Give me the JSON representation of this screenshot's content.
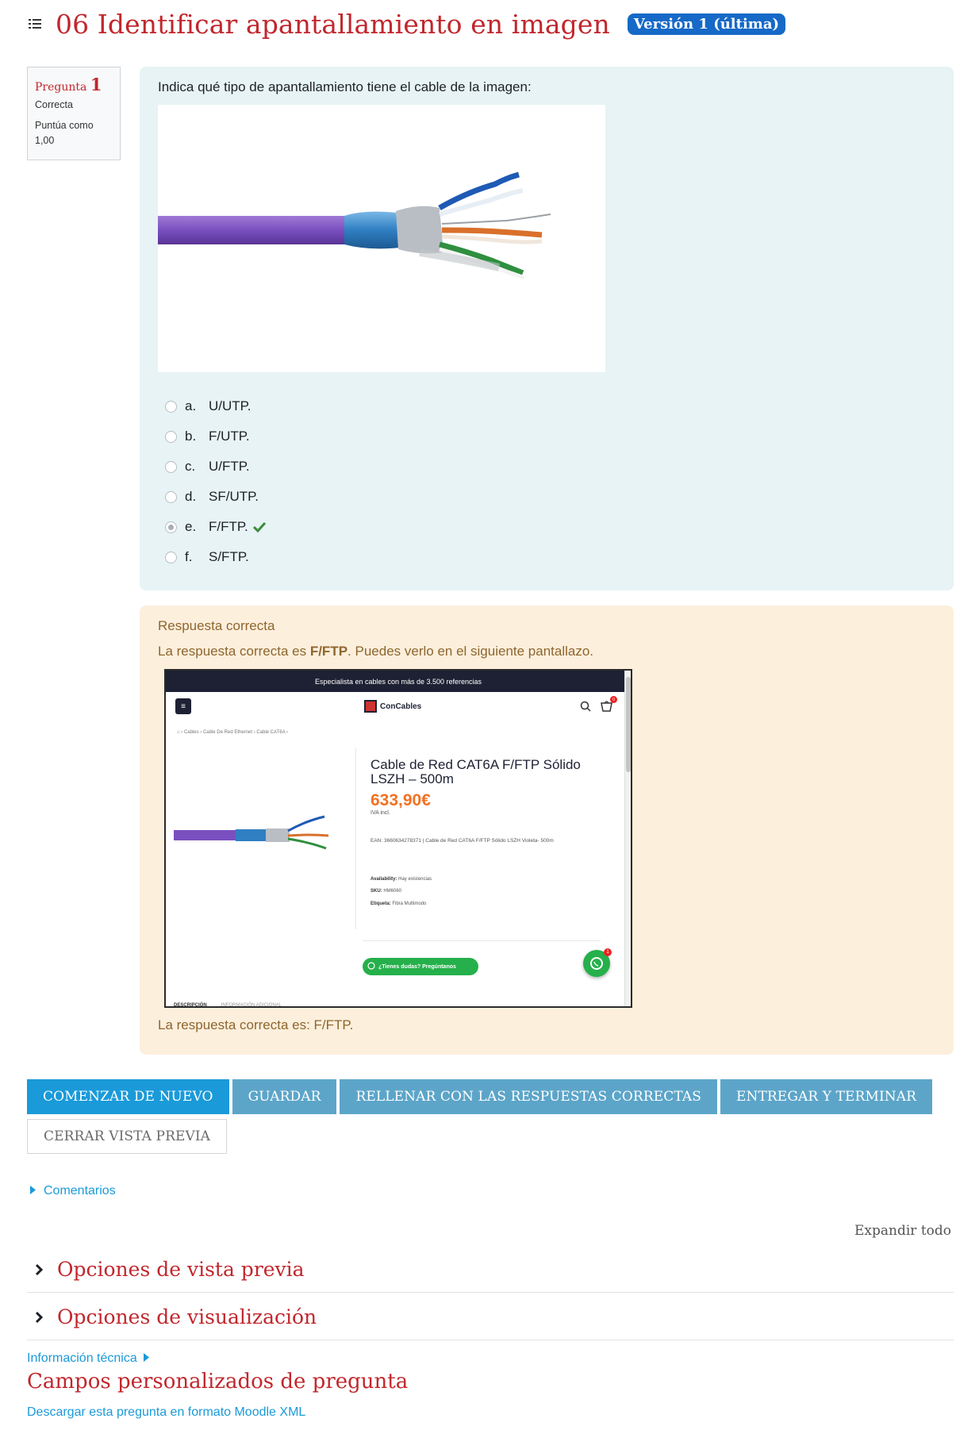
{
  "header": {
    "title": "06 Identificar apantallamiento en imagen",
    "version_badge": "Versión 1 (última)"
  },
  "question_info": {
    "label": "Pregunta",
    "number": "1",
    "state": "Correcta",
    "grade": "Puntúa como 1,00"
  },
  "question": {
    "prompt": "Indica qué tipo de apantallamiento tiene el cable de la imagen:",
    "answers": [
      {
        "letter": "a.",
        "text": "U/UTP.",
        "selected": false
      },
      {
        "letter": "b.",
        "text": "F/UTP.",
        "selected": false
      },
      {
        "letter": "c.",
        "text": "U/FTP.",
        "selected": false
      },
      {
        "letter": "d.",
        "text": "SF/UTP.",
        "selected": false
      },
      {
        "letter": "e.",
        "text": "F/FTP.",
        "selected": true
      },
      {
        "letter": "f.",
        "text": "S/FTP.",
        "selected": false
      }
    ]
  },
  "feedback": {
    "heading": "Respuesta correcta",
    "line_prefix": "La respuesta correcta es ",
    "line_bold": "F/FTP",
    "line_suffix": ". Puedes verlo en el siguiente pantallazo.",
    "final": "La respuesta correcta es: F/FTP."
  },
  "screenshot": {
    "topbar": "Especialista en cables con más de 3.500 referencias",
    "logo": "ConCables",
    "breadcrumb": "⌂ › Cables › Cable De Red Ethernet › Cable CAT6A ›",
    "product_title": "Cable de Red CAT6A F/FTP Sólido LSZH – 500m",
    "price": "633,90€",
    "iva": "IVA incl.",
    "ean": "EAN: 3660634278371 | Cable de Red CAT6A F/FTP Sólido LSZH Violeta- 500m",
    "availability_label": "Availability:",
    "availability_value": "Hay existencias",
    "sku_label": "SKU:",
    "sku_value": "HM6060",
    "tag_label": "Etiqueta:",
    "tag_value": "Fibra Multimodo",
    "whatsapp_button": "¿Tienes dudas? Pregúntanos",
    "whatsapp_badge": "1",
    "cart_badge": "0",
    "tab1": "DESCRIPCIÓN",
    "tab2": "INFORMACIÓN ADICIONAL"
  },
  "buttons": {
    "restart": "Comenzar de nuevo",
    "save": "Guardar",
    "fill_correct": "Rellenar con las respuestas correctas",
    "submit": "Entregar y terminar",
    "close_preview": "Cerrar vista previa"
  },
  "links": {
    "comments": "Comentarios",
    "expand_all": "Expandir todo",
    "tech_info": "Información técnica",
    "download": "Descargar esta pregunta en formato Moodle XML"
  },
  "sections": {
    "preview_options": "Opciones de vista previa",
    "display_options": "Opciones de visualización",
    "custom_fields": "Campos personalizados de pregunta"
  },
  "colors": {
    "title_red": "#c1272d",
    "badge_blue": "#1669c7",
    "link_blue": "#1a9ad9",
    "question_bg": "#e7f3f5",
    "feedback_bg": "#fcefdc",
    "check_green": "#3c8b3c"
  },
  "icons": [
    "list-menu-icon",
    "checkmark-icon",
    "chevron-right-icon",
    "caret-right-icon",
    "search-icon",
    "cart-icon",
    "whatsapp-icon"
  ]
}
